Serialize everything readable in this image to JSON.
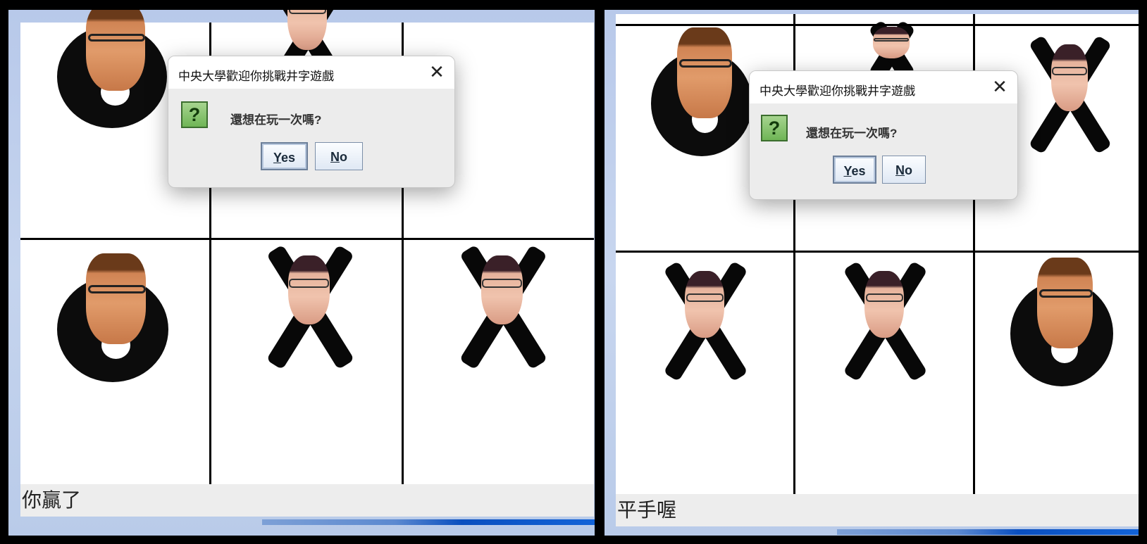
{
  "screens": [
    {
      "dialog": {
        "title": "中央大學歡迎你挑戰井字遊戲",
        "message": "還想在玩一次嗎?",
        "yes_mnemonic": "Y",
        "yes_rest": "es",
        "no_mnemonic": "N",
        "no_rest": "o",
        "icon": "question-icon"
      },
      "status": "你贏了",
      "board": [
        "O",
        "X",
        "",
        "O",
        "X",
        "X"
      ]
    },
    {
      "dialog": {
        "title": "中央大學歡迎你挑戰井字遊戲",
        "message": "還想在玩一次嗎?",
        "yes_mnemonic": "Y",
        "yes_rest": "es",
        "no_mnemonic": "N",
        "no_rest": "o",
        "icon": "question-icon"
      },
      "status": "平手喔",
      "board": [
        "O",
        "X",
        "X",
        "X",
        "X",
        "O"
      ]
    }
  ],
  "colors": {
    "dialog_bg": "#ececec",
    "accent_taskbar": "#0a4fbf",
    "question_icon": "#6fb556"
  }
}
